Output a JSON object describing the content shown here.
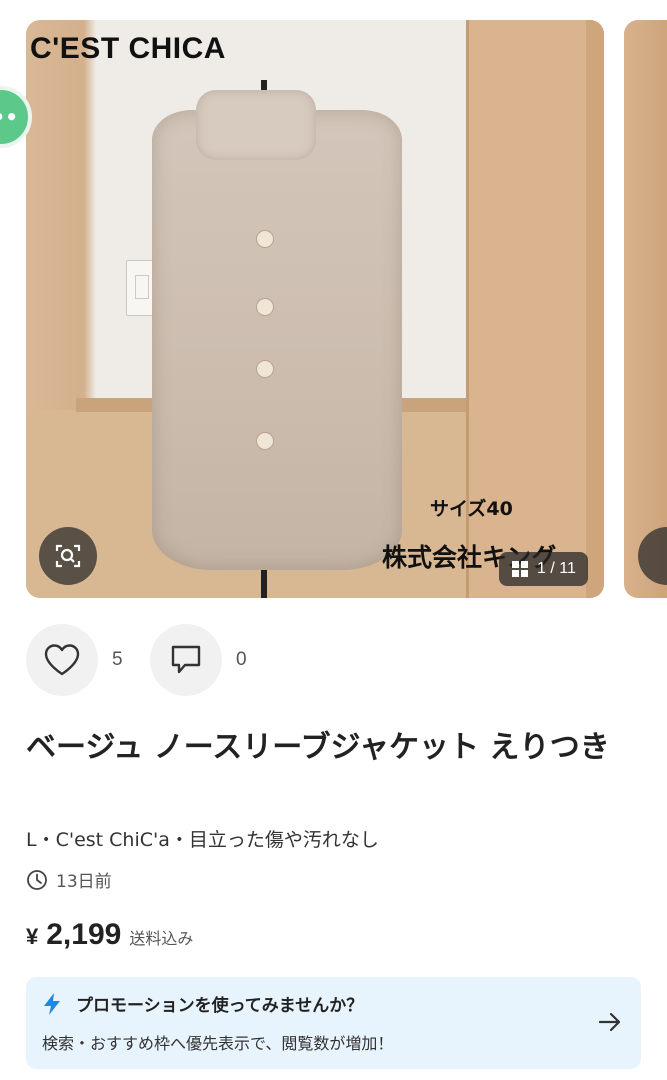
{
  "listing": {
    "photo": {
      "watermark_brand": "C'EST CHICA",
      "watermark_size": "サイズ40",
      "watermark_company": "株式会社キング",
      "counter": "1 / 11",
      "icon_lens": "image-search-icon",
      "icon_grid": "grid-icon"
    },
    "actions": {
      "likes": "5",
      "comments": "0"
    },
    "title": "ベージュ ノースリーブジャケット えりつき",
    "meta": "L・C'est ChiC'a・目立った傷や汚れなし",
    "posted": "13日前",
    "price": {
      "currency": "¥",
      "value": "2,199",
      "note": "送料込み"
    },
    "promo": {
      "title": "プロモーションを使ってみませんか？",
      "subtitle": "検索・おすすめ枠へ優先表示で、閲覧数が増加！"
    }
  },
  "colors": {
    "accent_green": "#5cc98a",
    "promo_bg": "#e8f4fd",
    "promo_icon": "#1e88e5"
  }
}
